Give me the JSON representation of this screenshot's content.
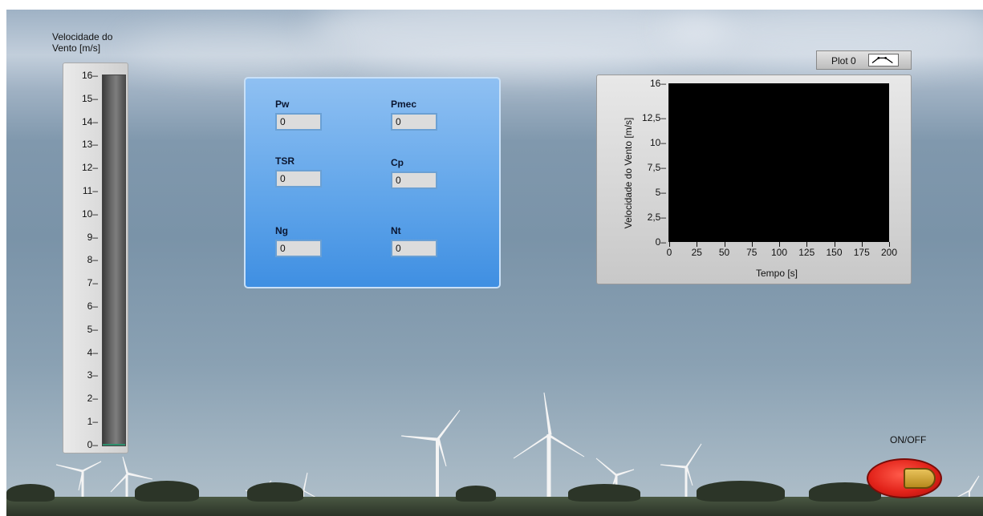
{
  "tank": {
    "label_line1": "Velocidade do",
    "label_line2": "Vento [m/s]",
    "ticks": [
      "16",
      "15",
      "14",
      "13",
      "12",
      "11",
      "10",
      "9",
      "8",
      "7",
      "6",
      "5",
      "4",
      "3",
      "2",
      "1",
      "0"
    ],
    "value": 0
  },
  "indicators": {
    "pw": {
      "label": "Pw",
      "value": "0"
    },
    "pmec": {
      "label": "Pmec",
      "value": "0"
    },
    "tsr": {
      "label": "TSR",
      "value": "0"
    },
    "cp": {
      "label": "Cp",
      "value": "0"
    },
    "ng": {
      "label": "Ng",
      "value": "0"
    },
    "nt": {
      "label": "Nt",
      "value": "0"
    }
  },
  "graph": {
    "legend": "Plot 0",
    "ylabel": "Velocidade do Vento [m/s]",
    "xlabel": "Tempo [s]",
    "yticks": [
      "16",
      "12,5",
      "10",
      "7,5",
      "5",
      "2,5",
      "0"
    ],
    "xticks": [
      "0",
      "25",
      "50",
      "75",
      "100",
      "125",
      "150",
      "175",
      "200"
    ],
    "plot_bg": "#000000"
  },
  "chart_data": {
    "type": "line",
    "title": "",
    "xlabel": "Tempo [s]",
    "ylabel": "Velocidade do Vento [m/s]",
    "xlim": [
      0,
      200
    ],
    "ylim": [
      0,
      16
    ],
    "series": []
  },
  "button": {
    "label": "ON/OFF",
    "state": "off",
    "color": "#e2231a"
  },
  "icons": {
    "legend_icon": "plot-line-icon"
  }
}
